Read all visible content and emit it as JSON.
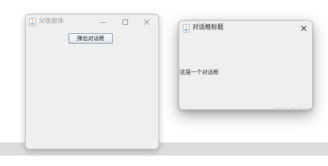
{
  "parent_window": {
    "title": "父级窗体",
    "open_dialog_button_label": "弹出对话框"
  },
  "dialog_window": {
    "title": "对话框标题",
    "message": "这是一个对话框"
  },
  "watermark": "CSDN @0不ok!",
  "icons": {
    "app": "java-icon",
    "minimize": "minimize-icon",
    "maximize": "maximize-icon",
    "close": "close-icon"
  },
  "colors": {
    "window_bg": "#efefef",
    "button_border": "#7a8fa7",
    "java_blue": "#5382a1",
    "java_orange": "#e76f00"
  }
}
